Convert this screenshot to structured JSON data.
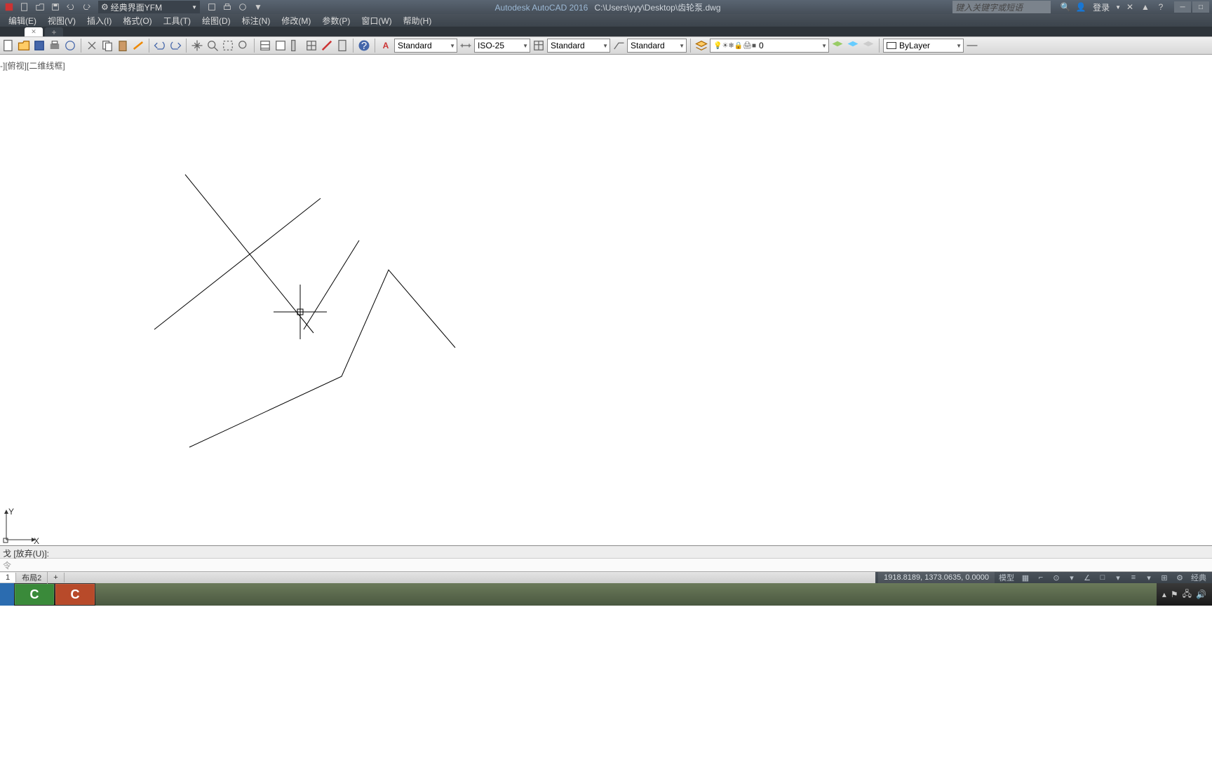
{
  "title": {
    "app": "Autodesk AutoCAD 2016",
    "path": "C:\\Users\\yyy\\Desktop\\齿轮泵.dwg"
  },
  "workspace": "经典界面YFM",
  "search_placeholder": "键入关键字或短语",
  "login": "登录",
  "menu": [
    "编辑(E)",
    "视图(V)",
    "插入(I)",
    "格式(O)",
    "工具(T)",
    "绘图(D)",
    "标注(N)",
    "修改(M)",
    "参数(P)",
    "窗口(W)",
    "帮助(H)"
  ],
  "styles": {
    "text": "Standard",
    "dim": "ISO-25",
    "table": "Standard",
    "mleader": "Standard"
  },
  "layer": {
    "name": "0"
  },
  "linetype": "ByLayer",
  "view_label": "-][俯视][二维线框]",
  "ucs": {
    "x": "X",
    "y": "Y"
  },
  "cmd": {
    "hist": "戈 [放弃(U)]:",
    "prompt": "令"
  },
  "tabs": {
    "model": "1",
    "layout1": "布局2",
    "add": "+"
  },
  "status": {
    "coords": "1918.8189, 1373.0635, 0.0000",
    "model": "模型",
    "ws": "经典"
  }
}
